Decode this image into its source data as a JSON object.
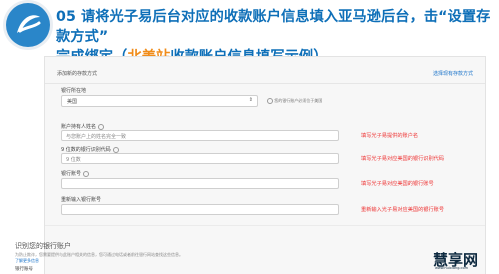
{
  "heading": {
    "line1": "05 请将光子易后台对应的收款账户信息填入亚马逊后台，击“设置存款方式”",
    "line2_pre": "完成绑定（",
    "line2_highlight": "北美站",
    "line2_post": "收款账户信息填写示例）"
  },
  "panel": {
    "title": "添加新的存款方式",
    "link": "选择现有存款方式"
  },
  "form": {
    "country_label": "银行所在地",
    "country_value": "美国",
    "country_help": "您的银行账户必须位于美国",
    "holder_label": "账户持有人姓名",
    "holder_placeholder": "与您账户上的姓名完全一致",
    "holder_note": "填写光子易提供的账户名",
    "routing_label": "9 位数的银行识别代码",
    "routing_placeholder": "9 位数",
    "routing_note": "填写光子易对应美国的银行识别代码",
    "account_label": "银行账号",
    "account_note": "填写光子易对应美国的银行账号",
    "reenter_label": "重新输入银行账号",
    "reenter_note": "重新输入光子易对应美国的银行账号"
  },
  "section": {
    "title": "识别您的银行账户",
    "desc": "为防止欺诈，您需要提供与此账户相关的信息，您可通过电话或者前往银行网站查找这些信息。",
    "link": "了解更多信息",
    "field_label": "银行账号"
  },
  "watermark": {
    "text": "慧享网",
    "sub": "www.huixiang.com"
  }
}
